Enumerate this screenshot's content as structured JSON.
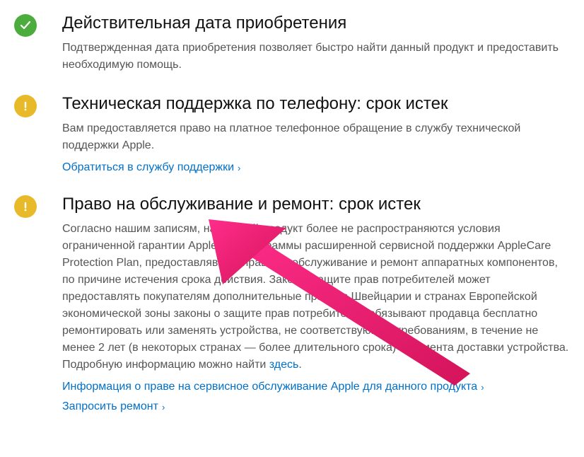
{
  "sections": [
    {
      "status": "green",
      "title": "Действительная дата приобретения",
      "desc": "Подтвержденная дата приобретения позволяет быстро найти данный продукт и предоставить необходимую помощь.",
      "links": []
    },
    {
      "status": "yellow",
      "title": "Техническая поддержка по телефону: срок истек",
      "desc": "Вам предоставляется право на платное телефонное обращение в службу технической поддержки Apple.",
      "links": [
        "Обратиться в службу поддержки"
      ]
    },
    {
      "status": "yellow",
      "title": "Право на обслуживание и ремонт: срок истек",
      "desc_before": "Согласно нашим записям, на данный продукт более не распространяются условия ограниченной гарантии Apple или программы расширенной сервисной поддержки AppleCare Protection Plan, предоставлявших право на обслуживание и ремонт аппаратных компонентов, по причине истечения срока действия. Закон о защите прав потребителей может предоставлять покупателям дополнительные права: в Швейцарии и странах Европейской экономической зоны законы о защите прав потребителей обязывают продавца бесплатно ремонтировать или заменять устройства, не соответствующие требованиям, в течение не менее 2 лет (в некоторых странах — более длительного срока) с момента доставки устройства. Подробную информацию можно найти ",
      "inline_link": "здесь",
      "desc_after": ".",
      "links": [
        "Информация о праве на сервисное обслуживание Apple для данного продукта",
        "Запросить ремонт"
      ]
    }
  ],
  "colors": {
    "green": "#4cad3e",
    "yellow": "#e8b929",
    "link": "#0070c9",
    "arrow": "#e83e8c"
  }
}
